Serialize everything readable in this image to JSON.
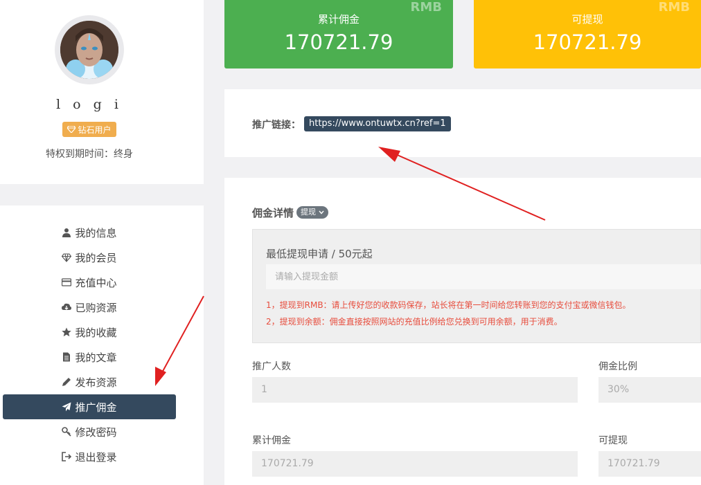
{
  "profile": {
    "username": "l o g i",
    "vip_label": "钻石用户",
    "expire_text": "特权到期时间：终身"
  },
  "menu": {
    "items": [
      {
        "label": "我的信息",
        "icon": "user-icon"
      },
      {
        "label": "我的会员",
        "icon": "diamond-icon"
      },
      {
        "label": "充值中心",
        "icon": "credit-card-icon"
      },
      {
        "label": "已购资源",
        "icon": "cloud-download-icon"
      },
      {
        "label": "我的收藏",
        "icon": "star-icon"
      },
      {
        "label": "我的文章",
        "icon": "file-icon"
      },
      {
        "label": "发布资源",
        "icon": "pencil-icon"
      },
      {
        "label": "推广佣金",
        "icon": "paper-plane-icon",
        "active": true
      },
      {
        "label": "修改密码",
        "icon": "key-icon"
      },
      {
        "label": "退出登录",
        "icon": "sign-out-icon"
      }
    ]
  },
  "stats": {
    "total": {
      "label": "累计佣金",
      "value": "170721.79",
      "currency": "RMB",
      "color": "#4caf50"
    },
    "withdrawable": {
      "label": "可提现",
      "value": "170721.79",
      "currency": "RMB",
      "color": "#ffc107"
    }
  },
  "referral": {
    "label": "推广链接：",
    "url": "https://www.ontuwtx.cn?ref=1"
  },
  "detail": {
    "title": "佣金详情",
    "withdraw_tag": "提现",
    "min_label": "最低提现申请 / 50元起",
    "amount_placeholder": "请输入提现金额",
    "notes": [
      "1，提现到RMB：请上传好您的收款码保存，站长将在第一时间给您转账到您的支付宝或微信钱包。",
      "2，提现到余额：佣金直接按照网站的充值比例给您兑换到可用余额，用于消费。"
    ],
    "fields": {
      "referral_count": {
        "label": "推广人数",
        "value": "1"
      },
      "commission_rate": {
        "label": "佣金比例",
        "value": "30%"
      },
      "total_commission": {
        "label": "累计佣金",
        "value": "170721.79"
      },
      "withdrawable": {
        "label": "可提现",
        "value": "170721.79"
      }
    }
  },
  "accent": "#34495e",
  "annotation_color": "#e02020"
}
